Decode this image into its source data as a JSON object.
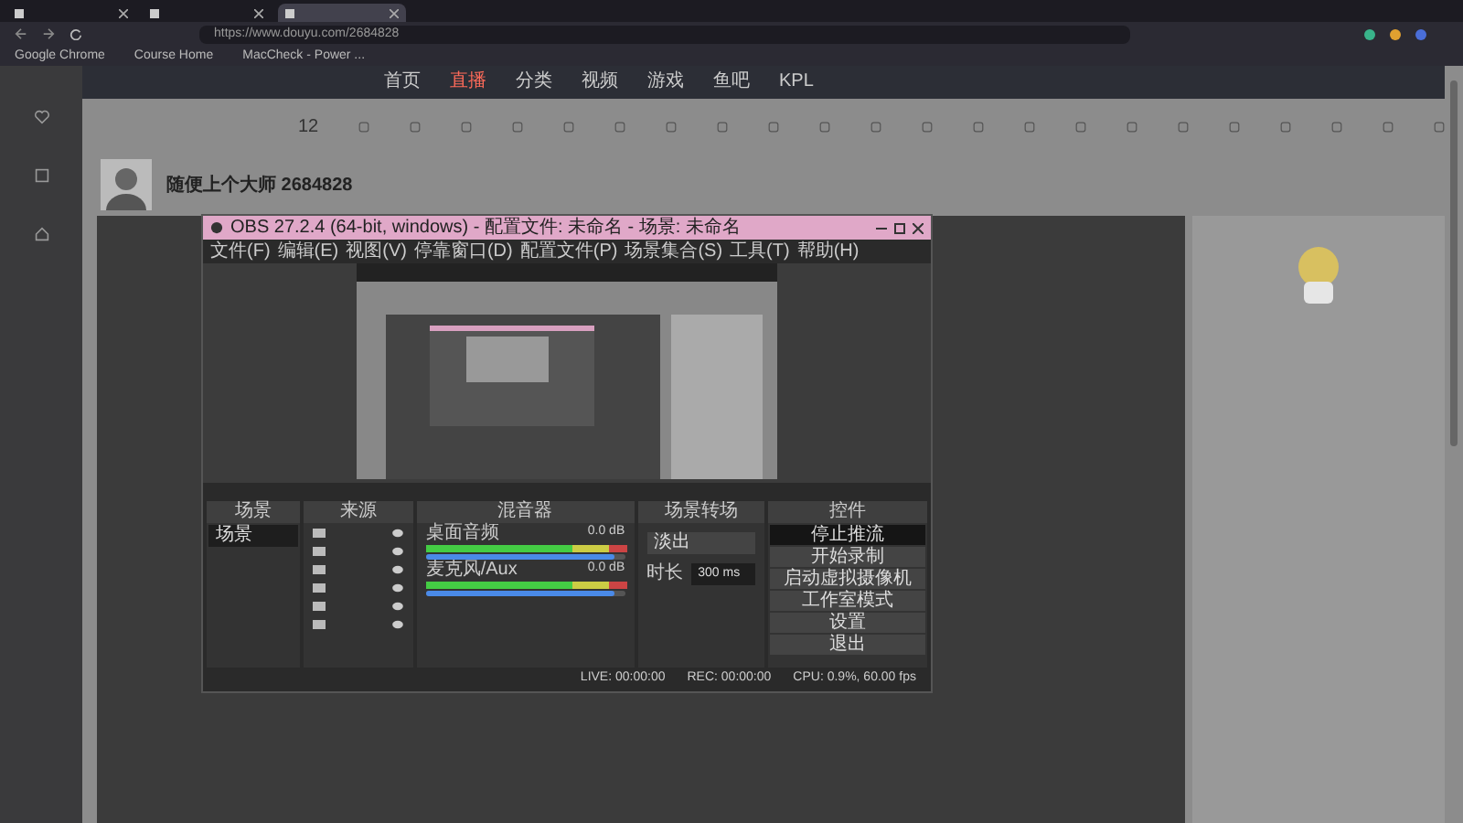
{
  "browser": {
    "tabs": [
      {
        "selected": false
      },
      {
        "selected": false
      },
      {
        "selected": true
      }
    ],
    "url": "https://www.douyu.com/2684828",
    "bookmarks": [
      "Google Chrome",
      "Course Home",
      "MacCheck - Power ..."
    ]
  },
  "site": {
    "nav": [
      {
        "label": "首页",
        "selected": false
      },
      {
        "label": "直播",
        "selected": true
      },
      {
        "label": "分类",
        "selected": false
      },
      {
        "label": "视频",
        "selected": false
      },
      {
        "label": "游戏",
        "selected": false
      },
      {
        "label": "鱼吧",
        "selected": false
      },
      {
        "label": "KPL",
        "selected": false
      }
    ],
    "followers": "12",
    "streamer": {
      "name": "随便上个大师",
      "room": "2684828"
    }
  },
  "obs": {
    "title": "OBS 27.2.4 (64-bit, windows) - 配置文件: 未命名 - 场景: 未命名",
    "menus": [
      "文件(F)",
      "编辑(E)",
      "视图(V)",
      "停靠窗口(D)",
      "配置文件(P)",
      "场景集合(S)",
      "工具(T)",
      "帮助(H)"
    ],
    "docks": [
      "场景",
      "来源",
      "混音器",
      "场景转场",
      "控件"
    ],
    "scenes": [
      {
        "label": "场景",
        "selected": true
      }
    ],
    "mixer": [
      {
        "name": "桌面音频",
        "reading": "0.0 dB",
        "level": 0.95
      },
      {
        "name": "麦克风/Aux",
        "reading": "0.0 dB",
        "level": 0.95
      }
    ],
    "transition": {
      "value": "淡出",
      "duration_label": "时长",
      "duration": "300 ms"
    },
    "controls": [
      {
        "label": "停止推流",
        "active": true
      },
      {
        "label": "开始录制",
        "active": false
      },
      {
        "label": "启动虚拟摄像机",
        "active": false
      },
      {
        "label": "工作室模式",
        "active": false
      },
      {
        "label": "设置",
        "active": false
      },
      {
        "label": "退出",
        "active": false
      }
    ],
    "status": {
      "live": "LIVE: 00:00:00",
      "rec": "REC: 00:00:00",
      "cpu": "CPU: 0.9%, 60.00 fps"
    }
  }
}
